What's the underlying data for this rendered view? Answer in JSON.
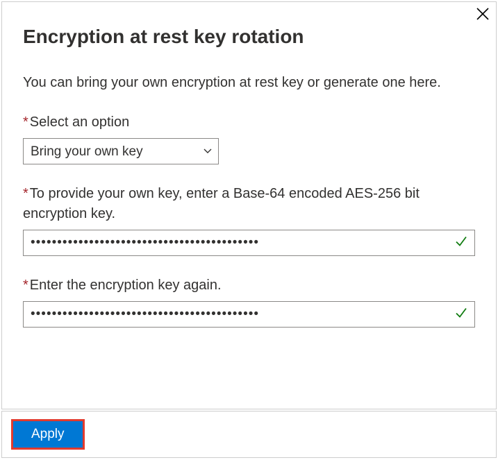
{
  "header": {
    "title": "Encryption at rest key rotation"
  },
  "description": "You can bring your own encryption at rest key or generate one here.",
  "asterisk": "*",
  "fields": {
    "option": {
      "label": "Select an option",
      "selected": "Bring your own key"
    },
    "key1": {
      "label": "To provide your own key, enter a Base-64 encoded AES-256 bit encryption key.",
      "value": "•••••••••••••••••••••••••••••••••••••••••••"
    },
    "key2": {
      "label": "Enter the encryption key again.",
      "value": "•••••••••••••••••••••••••••••••••••••••••••"
    }
  },
  "footer": {
    "apply_label": "Apply"
  }
}
